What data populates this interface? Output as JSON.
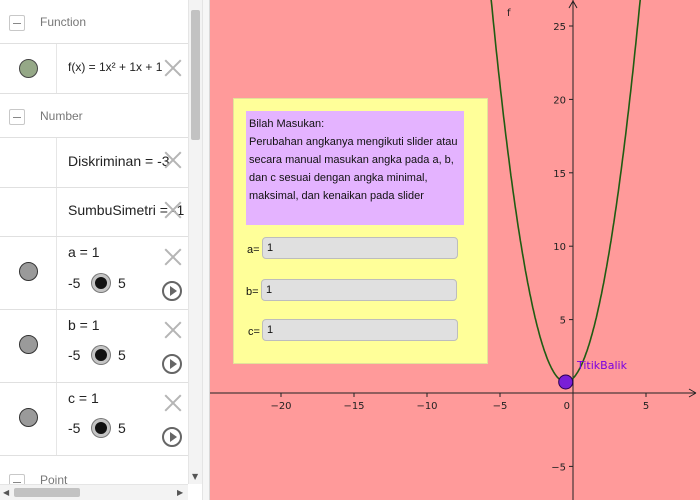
{
  "algebra": {
    "groups": {
      "function": "Function",
      "number": "Number",
      "point": "Point"
    },
    "function_row": {
      "expr": "f(x) = 1x² + 1x + 1"
    },
    "diskriminan": "Diskriminan = -3",
    "sumbu_simetri": "SumbuSimetri = -1",
    "sliders": [
      {
        "label": "a = 1",
        "min": "-5",
        "max": "5"
      },
      {
        "label": "b = 1",
        "min": "-5",
        "max": "5"
      },
      {
        "label": "c = 1",
        "min": "-5",
        "max": "5"
      }
    ]
  },
  "graphics": {
    "curve_label": "f",
    "point_label": "TitikBalik",
    "x_ticks": [
      "−20",
      "−15",
      "−10",
      "−5",
      "0",
      "5"
    ],
    "y_ticks": [
      "25",
      "20",
      "15",
      "10",
      "5",
      "−5"
    ],
    "panel": {
      "title": "Bilah Masukan:",
      "text": "Perubahan angkanya mengikuti slider atau secara manual masukan angka pada a, b, dan c sesuai dengan angka minimal, maksimal, dan kenaikan pada slider",
      "inputs": [
        {
          "label": "a=",
          "value": "1"
        },
        {
          "label": "b=",
          "value": "1"
        },
        {
          "label": "c=",
          "value": "1"
        }
      ]
    }
  },
  "colors": {
    "graphics_bg": "#ff9a9a",
    "curve": "#1f5c12",
    "point": "#7a1fd6",
    "panel_bg": "#ffff99",
    "instructions_bg": "#e4b3ff"
  }
}
